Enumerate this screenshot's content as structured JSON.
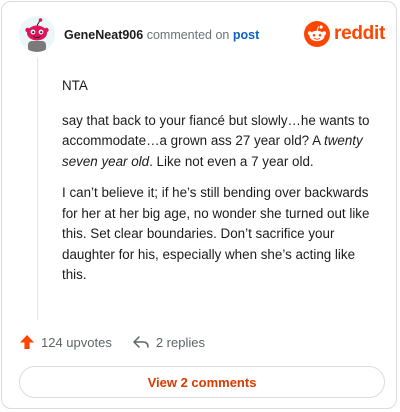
{
  "header": {
    "username": "GeneNeat906",
    "action_text": "commented on",
    "post_link": "post",
    "brand_name": "reddit"
  },
  "comment": {
    "paragraphs": {
      "p0": "NTA",
      "p1a": "say that back to your fiancé but slowly…he wants to accommodate…a grown ass 27 year old? A ",
      "p1em": "twenty seven year old",
      "p1b": ". Like not even a 7 year old.",
      "p2": "I can’t believe it; if he’s still bending over backwards for her at her big age, no wonder she turned out like this. Set clear boundaries. Don’t sacrifice your daughter for his, especially when she’s acting like this."
    }
  },
  "actions": {
    "upvotes_label": "124 upvotes",
    "replies_label": "2 replies"
  },
  "footer": {
    "view_comments_label": "View 2 comments"
  },
  "colors": {
    "brand": "#ff4500",
    "link": "#0b62c4",
    "upvote": "#ff4500",
    "view_comments": "#d93a00"
  },
  "icons": {
    "avatar": "snoo-avatar-icon",
    "brand": "reddit-logo-icon",
    "upvote": "upvote-arrow-icon",
    "reply": "reply-arrow-icon"
  }
}
